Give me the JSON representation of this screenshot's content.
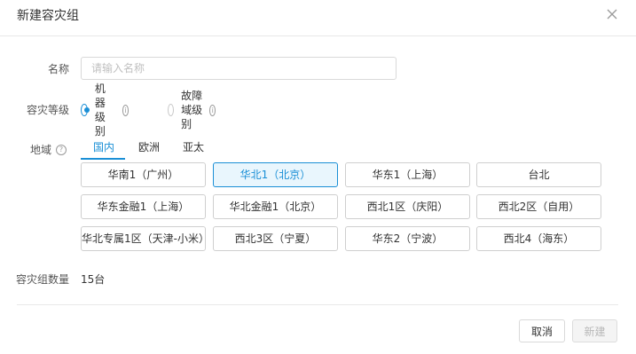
{
  "dialog": {
    "title": "新建容灾组",
    "name_label": "名称",
    "name_placeholder": "请输入名称",
    "name_value": "",
    "level_label": "容灾等级",
    "level_options": [
      {
        "label": "机器级别",
        "checked": true
      },
      {
        "label": "故障域级别",
        "checked": false
      }
    ],
    "region_label": "地域",
    "region_tabs": [
      {
        "label": "国内",
        "active": true
      },
      {
        "label": "欧洲",
        "active": false
      },
      {
        "label": "亚太",
        "active": false
      }
    ],
    "regions": [
      {
        "label": "华南1（广州）",
        "selected": false
      },
      {
        "label": "华北1（北京）",
        "selected": true
      },
      {
        "label": "华东1（上海）",
        "selected": false
      },
      {
        "label": "台北",
        "selected": false
      },
      {
        "label": "华东金融1（上海）",
        "selected": false
      },
      {
        "label": "华北金融1（北京）",
        "selected": false
      },
      {
        "label": "西北1区（庆阳）",
        "selected": false
      },
      {
        "label": "西北2区（自用）",
        "selected": false
      },
      {
        "label": "华北专属1区（天津-小米）",
        "selected": false
      },
      {
        "label": "西北3区（宁夏）",
        "selected": false
      },
      {
        "label": "华东2（宁波）",
        "selected": false
      },
      {
        "label": "西北4（海东）",
        "selected": false
      }
    ],
    "count_label": "容灾组数量",
    "count_value": "15台",
    "cancel_label": "取消",
    "create_label": "新建",
    "accent_color": "#1a8fd6"
  }
}
